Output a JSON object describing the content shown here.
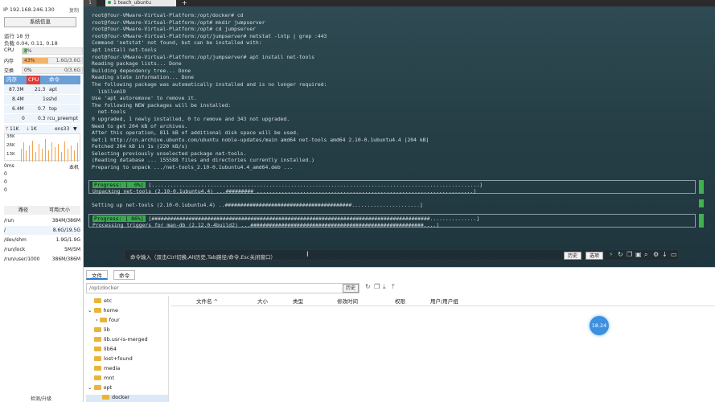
{
  "sidebar": {
    "ip": "IP 192.168.246.130",
    "copy": "复制",
    "sysinfo_btn": "系统信息",
    "uptime": "运行 18 分",
    "load": "负载 0.04, 0.11, 0.18",
    "cpu": {
      "label": "CPU",
      "pct": "8%",
      "value": 0.08
    },
    "mem": {
      "label": "内存",
      "pct": "43%",
      "right": "1.6G/3.6G",
      "value": 0.43
    },
    "swap": {
      "label": "交换",
      "pct": "0%",
      "right": "0/3.6G",
      "value": 0
    },
    "proc_head": [
      "内存",
      "CPU",
      "命令"
    ],
    "procs": [
      [
        "87.3M",
        "21.3",
        "apt"
      ],
      [
        "8.4M",
        "1",
        "sshd"
      ],
      [
        "6.4M",
        "0.7",
        "top"
      ],
      [
        "0",
        "0.3",
        "rcu_preempt"
      ]
    ],
    "net": {
      "up": "11K",
      "down": "1K",
      "iface": "ens33"
    },
    "graph_y": [
      "38K",
      "26K",
      "13K"
    ],
    "io": {
      "ms": "0ms",
      "local": "本机",
      "rows": [
        "0",
        "0",
        "0"
      ]
    },
    "disk_head": [
      "路径",
      "可用/大小"
    ],
    "disks": [
      [
        "/run",
        "384M/386M"
      ],
      [
        "/",
        "8.6G/19.5G"
      ],
      [
        "/dev/shm",
        "1.9G/1.9G"
      ],
      [
        "/run/lock",
        "5M/5M"
      ],
      [
        "/run/user/1000",
        "386M/386M"
      ]
    ],
    "footer": "检测/升级"
  },
  "tabs": {
    "first": "1",
    "active": "1 teach_ubuntu",
    "plus": "+"
  },
  "terminal": {
    "lines": [
      "root@four-VMware-Virtual-Platform:/opt/docker# cd",
      "root@four-VMware-Virtual-Platform:/opt# mkdir jumpserver",
      "root@four-VMware-Virtual-Platform:/opt# cd jumpserver",
      "root@four-VMware-Virtual-Platform:/opt/jumpserver# netstat -lntp | grep :443",
      "Command 'netstat' not found, but can be installed with:",
      "apt install net-tools",
      "root@four-VMware-Virtual-Platform:/opt/jumpserver# apt install net-tools",
      "Reading package lists... Done",
      "Building dependency tree... Done",
      "Reading state information... Done",
      "The following package was automatically installed and is no longer required:",
      "  libllvm19",
      "Use 'apt autoremove' to remove it.",
      "The following NEW packages will be installed:",
      "  net-tools",
      "0 upgraded, 1 newly installed, 0 to remove and 343 not upgraded.",
      "Need to get 204 kB of archives.",
      "After this operation, 811 kB of additional disk space will be used.",
      "Get:1 http://cn.archive.ubuntu.com/ubuntu noble-updates/main amd64 net-tools amd64 2.10-0.1ubuntu4.4 [204 kB]",
      "Fetched 204 kB in 1s (220 kB/s)",
      "Selecting previously unselected package net-tools.",
      "(Reading database ... 155588 files and directories currently installed.)",
      "Preparing to unpack .../net-tools_2.10-0.1ubuntu4.4_amd64.deb ..."
    ],
    "box1_prog": "Progress: [  0%]",
    "box1_line1": " [..........................................................................................................]",
    "box1_line2": "Unpacking net-tools (2.10-0.1ubuntu4.4) ...######### ......................................................................]",
    "setup_line": "Setting up net-tools (2.10-0.1ubuntu4.4) ..#########################################......................]",
    "box2_prog": "Progress: [ 86%]",
    "box2_line1": " [##########################################################################################...............]",
    "box2_line2": "Processing triggers for man-db (2.12.0-4build2) ...########################################################....]",
    "cmd_placeholder": "命令输入（双击Ctrl切换,Alt历史,Tab路径/命令,Esc关闭窗口）",
    "btn_history": "历史",
    "btn_options": "选项"
  },
  "bottom": {
    "tab_files": "文件",
    "tab_cmd": "命令",
    "path": "/opt/docker",
    "history": "历史",
    "tree": [
      "etc",
      "home",
      "four",
      "lib",
      "lib.usr-is-merged",
      "lib64",
      "lost+found",
      "media",
      "mnt",
      "opt",
      "docker"
    ],
    "cols": [
      "文件名 ^",
      "大小",
      "类型",
      "修改时间",
      "权限",
      "用户/用户组"
    ],
    "badge": "18.24"
  },
  "colors": {
    "terminal_bg": "#2a434b",
    "progress_green": "#3aa84f",
    "accent": "#2a7ad6"
  }
}
